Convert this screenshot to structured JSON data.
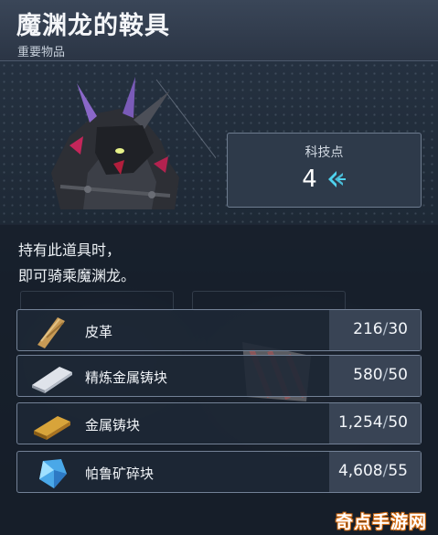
{
  "header": {
    "title": "魔渊龙的鞍具",
    "subtitle": "重要物品"
  },
  "tech_points": {
    "label": "科技点",
    "value": "4",
    "icon": "tech-point-icon"
  },
  "description": {
    "line1": "持有此道具时，",
    "line2": "即可骑乘魔渊龙。"
  },
  "materials": [
    {
      "name": "皮革",
      "have": "216",
      "need": "30",
      "icon": "leather-icon"
    },
    {
      "name": "精炼金属铸块",
      "have": "580",
      "need": "50",
      "icon": "refined-ingot-icon"
    },
    {
      "name": "金属铸块",
      "have": "1,254",
      "need": "50",
      "icon": "ingot-icon"
    },
    {
      "name": "帕鲁矿碎块",
      "have": "4,608",
      "need": "55",
      "icon": "pal-crystal-icon"
    }
  ],
  "watermark": "奇点手游网",
  "colors": {
    "accent_cyan": "#4fd2ee",
    "panel_border": "#738196",
    "header_bg": "#3a4658"
  }
}
